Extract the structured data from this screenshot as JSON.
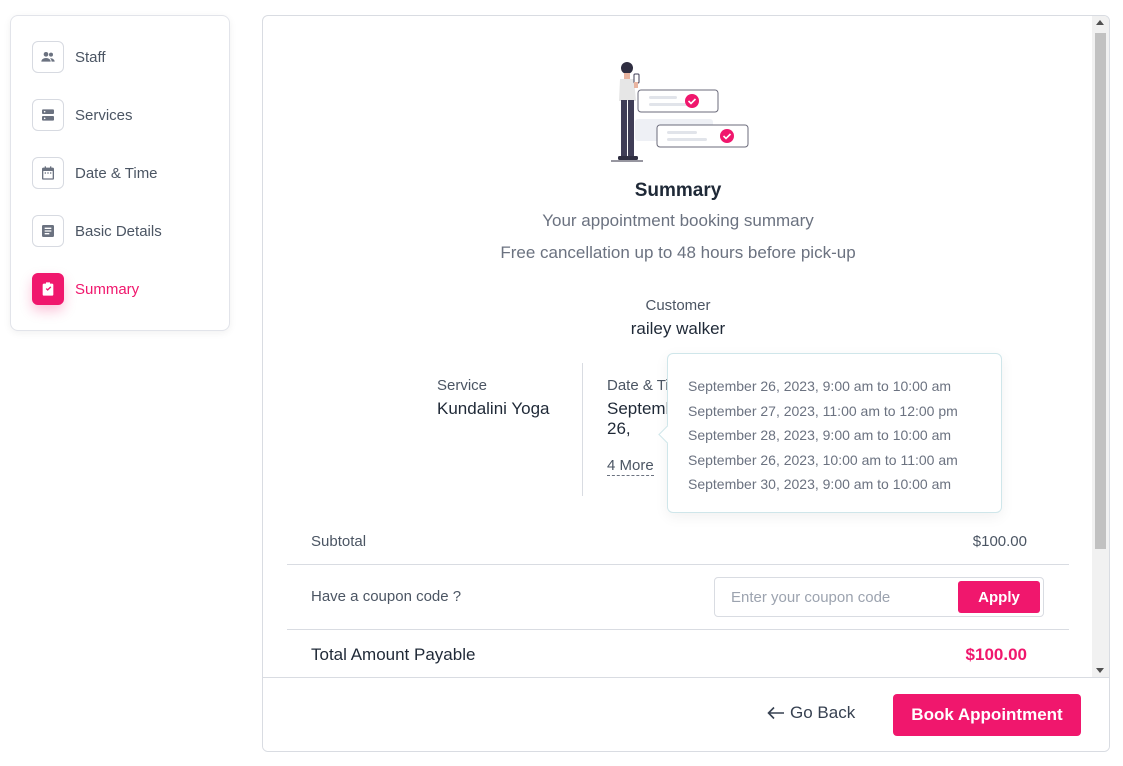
{
  "sidebar": {
    "items": [
      {
        "label": "Staff",
        "icon": "users-icon",
        "active": false
      },
      {
        "label": "Services",
        "icon": "server-icon",
        "active": false
      },
      {
        "label": "Date & Time",
        "icon": "calendar-icon",
        "active": false
      },
      {
        "label": "Basic Details",
        "icon": "document-icon",
        "active": false
      },
      {
        "label": "Summary",
        "icon": "clipboard-check-icon",
        "active": true
      }
    ]
  },
  "summary": {
    "title": "Summary",
    "subtitle": "Your appointment booking summary",
    "note": "Free cancellation up to 48 hours before pick-up",
    "customer_label": "Customer",
    "customer_value": "railey walker",
    "service_label": "Service",
    "service_value": "Kundalini Yoga",
    "datetime_label": "Date & Time",
    "datetime_value": "September 26, 2023, 9:00 am",
    "more_link": "4 More",
    "slots": [
      "September 26, 2023, 9:00 am to 10:00 am",
      "September 27, 2023, 11:00 am to 12:00 pm",
      "September 28, 2023, 9:00 am to 10:00 am",
      "September 26, 2023, 10:00 am to 11:00 am",
      "September 30, 2023, 9:00 am to 10:00 am"
    ]
  },
  "pricing": {
    "subtotal_label": "Subtotal",
    "subtotal_value": "$100.00",
    "coupon_label": "Have a coupon code ?",
    "coupon_placeholder": "Enter your coupon code",
    "coupon_value": "",
    "apply_label": "Apply",
    "total_label": "Total Amount Payable",
    "total_value": "$100.00"
  },
  "footer": {
    "back_label": "Go Back",
    "book_label": "Book Appointment"
  },
  "colors": {
    "accent": "#f0176d",
    "text": "#1f2937",
    "muted": "#6b7280",
    "border": "#d9dce2"
  }
}
